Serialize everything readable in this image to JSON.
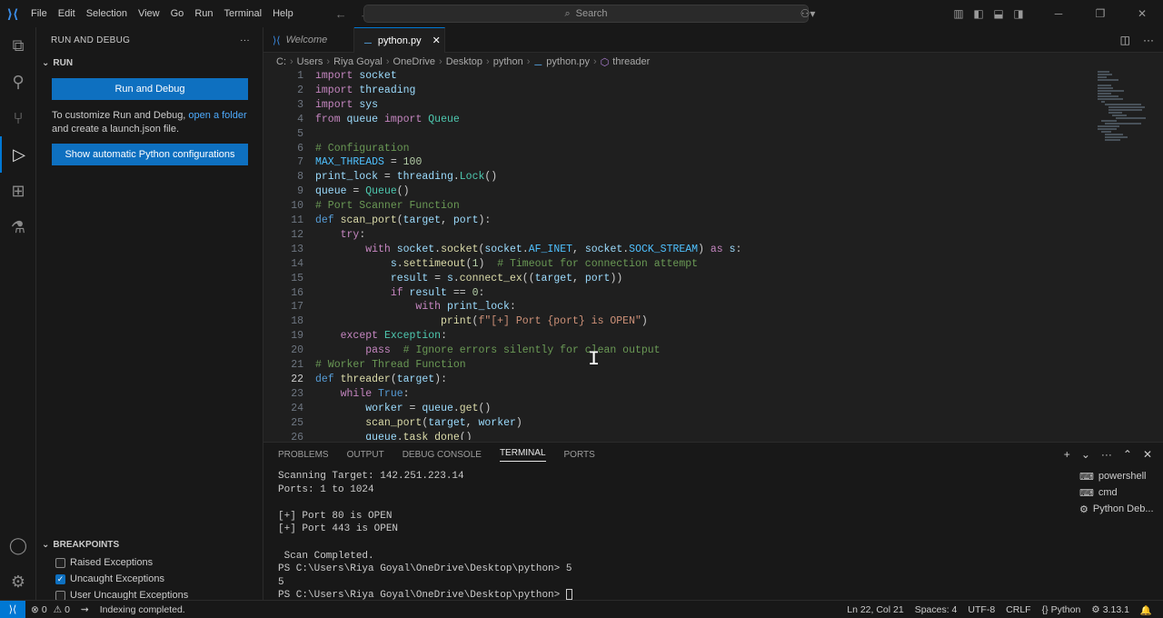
{
  "titlebar": {
    "menu": [
      "File",
      "Edit",
      "Selection",
      "View",
      "Go",
      "Run",
      "Terminal",
      "Help"
    ],
    "search_label": "Search"
  },
  "sidebar": {
    "header": "RUN AND DEBUG",
    "section": "RUN",
    "run_button": "Run and Debug",
    "info_prefix": "To customize Run and Debug, ",
    "info_link": "open a folder",
    "info_suffix": "and create a launch.json file.",
    "python_button": "Show automatic Python configurations",
    "breakpoints_header": "BREAKPOINTS",
    "breakpoints": [
      {
        "label": "Raised Exceptions",
        "checked": false
      },
      {
        "label": "Uncaught Exceptions",
        "checked": true
      },
      {
        "label": "User Uncaught Exceptions",
        "checked": false
      }
    ]
  },
  "tabs": [
    {
      "label": "Welcome",
      "active": false
    },
    {
      "label": "python.py",
      "active": true
    }
  ],
  "breadcrumb": [
    "C:",
    "Users",
    "Riya Goyal",
    "OneDrive",
    "Desktop",
    "python",
    "python.py",
    "threader"
  ],
  "editor": {
    "current_line": 22,
    "lines": [
      "import socket",
      "import threading",
      "import sys",
      "from queue import Queue",
      "",
      "# Configuration",
      "MAX_THREADS = 100",
      "print_lock = threading.Lock()",
      "queue = Queue()",
      "# Port Scanner Function",
      "def scan_port(target, port):",
      "    try:",
      "        with socket.socket(socket.AF_INET, socket.SOCK_STREAM) as s:",
      "            s.settimeout(1)  # Timeout for connection attempt",
      "            result = s.connect_ex((target, port))",
      "            if result == 0:",
      "                with print_lock:",
      "                    print(f\"[+] Port {port} is OPEN\")",
      "    except Exception:",
      "        pass  # Ignore errors silently for clean output",
      "# Worker Thread Function",
      "def threader(target):",
      "    while True:",
      "        worker = queue.get()",
      "        scan_port(target, worker)",
      "        queue.task_done()"
    ]
  },
  "panel": {
    "tabs": [
      "PROBLEMS",
      "OUTPUT",
      "DEBUG CONSOLE",
      "TERMINAL",
      "PORTS"
    ],
    "active_tab": "TERMINAL",
    "terminal_lines": [
      "Scanning Target: 142.251.223.14",
      "Ports: 1 to 1024",
      "",
      "[+] Port 80 is OPEN",
      "[+] Port 443 is OPEN",
      "",
      " Scan Completed.",
      "PS C:\\Users\\Riya Goyal\\OneDrive\\Desktop\\python> 5",
      "5",
      "PS C:\\Users\\Riya Goyal\\OneDrive\\Desktop\\python> "
    ],
    "terminal_list": [
      "powershell",
      "cmd",
      "Python Deb..."
    ]
  },
  "statusbar": {
    "errors": "0",
    "warnings": "0",
    "indexing": "Indexing completed.",
    "position": "Ln 22, Col 21",
    "spaces": "Spaces: 4",
    "encoding": "UTF-8",
    "eol": "CRLF",
    "language": "Python",
    "version": "3.13.1"
  }
}
